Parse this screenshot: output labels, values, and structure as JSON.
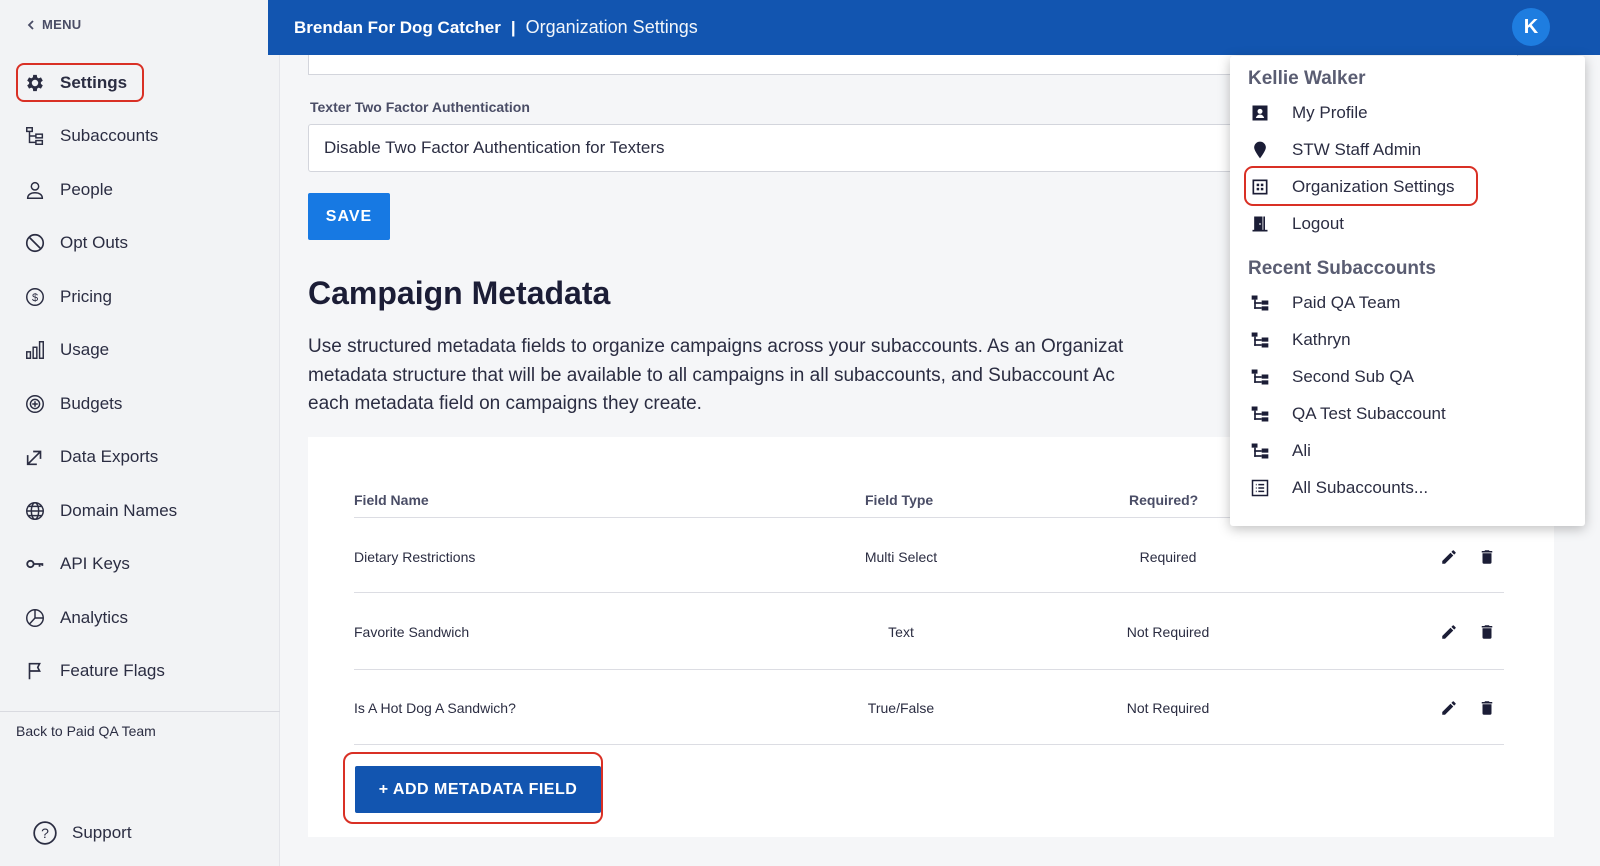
{
  "sidebar": {
    "menu_back": "MENU",
    "items": [
      {
        "label": "Settings",
        "icon": "gear-icon",
        "active": true
      },
      {
        "label": "Subaccounts",
        "icon": "hierarchy-icon"
      },
      {
        "label": "People",
        "icon": "person-icon"
      },
      {
        "label": "Opt Outs",
        "icon": "prohibited-icon"
      },
      {
        "label": "Pricing",
        "icon": "dollar-circle-icon"
      },
      {
        "label": "Usage",
        "icon": "bar-chart-icon"
      },
      {
        "label": "Budgets",
        "icon": "plus-circle-icon"
      },
      {
        "label": "Data Exports",
        "icon": "export-arrow-icon"
      },
      {
        "label": "Domain Names",
        "icon": "globe-icon"
      },
      {
        "label": "API Keys",
        "icon": "key-icon"
      },
      {
        "label": "Analytics",
        "icon": "pie-chart-icon"
      },
      {
        "label": "Feature Flags",
        "icon": "flag-icon"
      }
    ],
    "back_link": "Back to Paid QA Team",
    "support": "Support"
  },
  "header": {
    "org_name": "Brendan For Dog Catcher",
    "separator": "|",
    "page_title": "Organization Settings",
    "avatar_initial": "K"
  },
  "settings": {
    "two_factor_label": "Texter Two Factor Authentication",
    "two_factor_value": "Disable Two Factor Authentication for Texters",
    "save_label": "SAVE"
  },
  "campaign_metadata": {
    "title": "Campaign Metadata",
    "description_lines": [
      "Use structured metadata fields to organize campaigns across your subaccounts. As an Organizat",
      "metadata structure that will be available to all campaigns in all subaccounts, and Subaccount Ac",
      "each metadata field on campaigns they create."
    ],
    "columns": [
      "Field Name",
      "Field Type",
      "Required?"
    ],
    "rows": [
      {
        "name": "Dietary Restrictions",
        "type": "Multi Select",
        "required": "Required"
      },
      {
        "name": "Favorite Sandwich",
        "type": "Text",
        "required": "Not Required"
      },
      {
        "name": "Is A Hot Dog A Sandwich?",
        "type": "True/False",
        "required": "Not Required"
      }
    ],
    "add_label": "+ ADD METADATA FIELD"
  },
  "user_menu": {
    "user_name": "Kellie Walker",
    "items": [
      {
        "label": "My Profile",
        "icon": "profile-card-icon"
      },
      {
        "label": "STW Staff Admin",
        "icon": "shield-pin-icon"
      },
      {
        "label": "Organization Settings",
        "icon": "building-icon"
      },
      {
        "label": "Logout",
        "icon": "door-icon"
      }
    ],
    "recent_heading": "Recent Subaccounts",
    "recent": [
      {
        "label": "Paid QA Team",
        "icon": "hierarchy-icon"
      },
      {
        "label": "Kathryn",
        "icon": "hierarchy-icon"
      },
      {
        "label": "Second Sub QA",
        "icon": "hierarchy-icon"
      },
      {
        "label": "QA Test Subaccount",
        "icon": "hierarchy-icon"
      },
      {
        "label": "Ali",
        "icon": "hierarchy-icon"
      },
      {
        "label": "All Subaccounts...",
        "icon": "list-icon"
      }
    ]
  },
  "colors": {
    "header_blue": "#1255b0",
    "button_blue": "#1779e3",
    "highlight_red": "#d93025"
  }
}
